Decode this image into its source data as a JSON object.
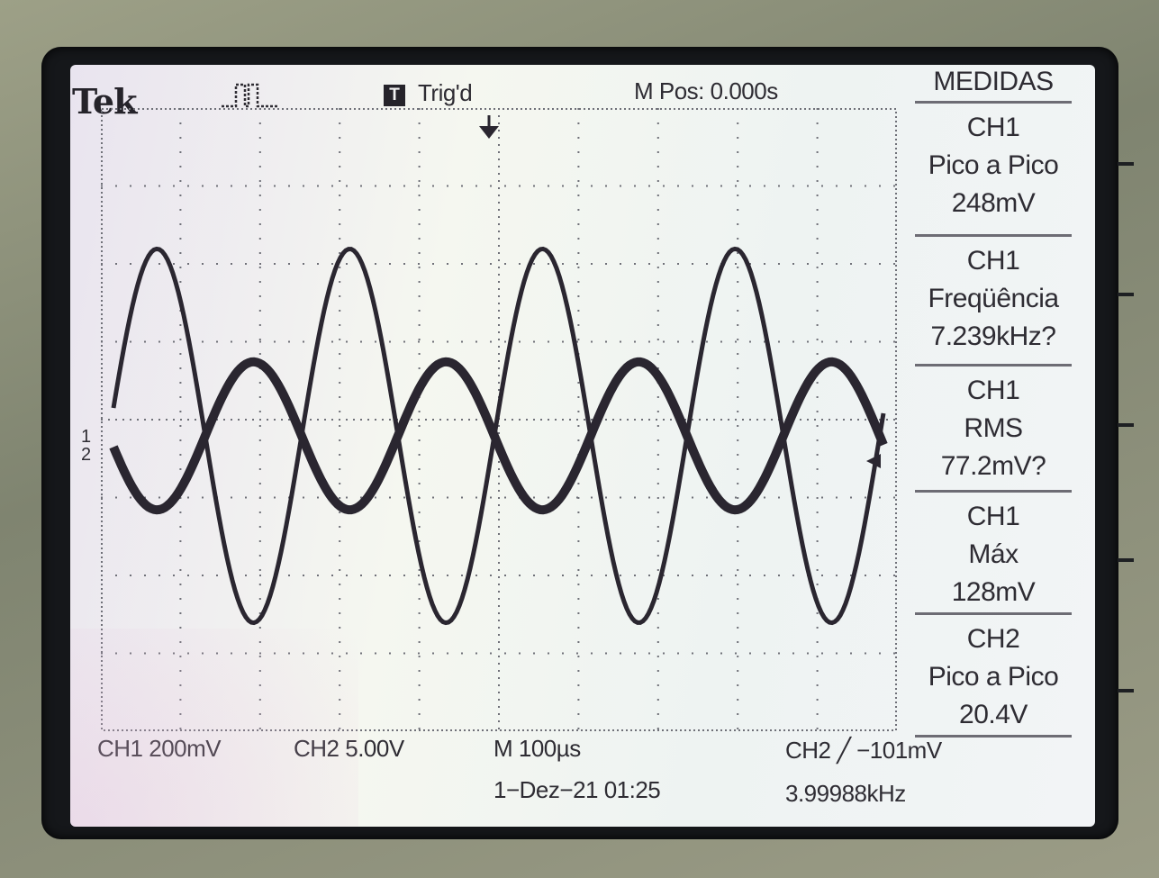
{
  "header": {
    "brand": "Tek",
    "trigger_badge": "T",
    "trigger_status": "Trig'd",
    "m_pos": "M Pos: 0.000s"
  },
  "measurements": {
    "title": "MEDIDAS",
    "items": [
      {
        "channel": "CH1",
        "label": "Pico a Pico",
        "value": "248mV"
      },
      {
        "channel": "CH1",
        "label": "Freqüência",
        "value": "7.239kHz?"
      },
      {
        "channel": "CH1",
        "label": "RMS",
        "value": "77.2mV?"
      },
      {
        "channel": "CH1",
        "label": "Máx",
        "value": "128mV"
      },
      {
        "channel": "CH2",
        "label": "Pico a Pico",
        "value": "20.4V"
      }
    ]
  },
  "footer": {
    "ch1_scale": "CH1  200mV",
    "ch2_scale": "CH2  5.00V",
    "timebase": "M 100µs",
    "trigger_info": "CH2 ╱ −101mV",
    "datetime": "1−Dez−21 01:25",
    "trigger_freq": "3.99988kHz"
  },
  "markers": {
    "ch1_marker": "1",
    "ch2_marker": "2"
  },
  "waveforms": {
    "ch1": {
      "divisions_pp": 4.8,
      "cycles_on_screen": 4.0,
      "phase_deg": 0
    },
    "ch2": {
      "divisions_pp": 1.9,
      "cycles_on_screen": 4.0,
      "phase_deg": 180
    }
  },
  "colors": {
    "trace": "#2a2630",
    "grid": "#6f7078",
    "screen": "#eef2ee"
  }
}
